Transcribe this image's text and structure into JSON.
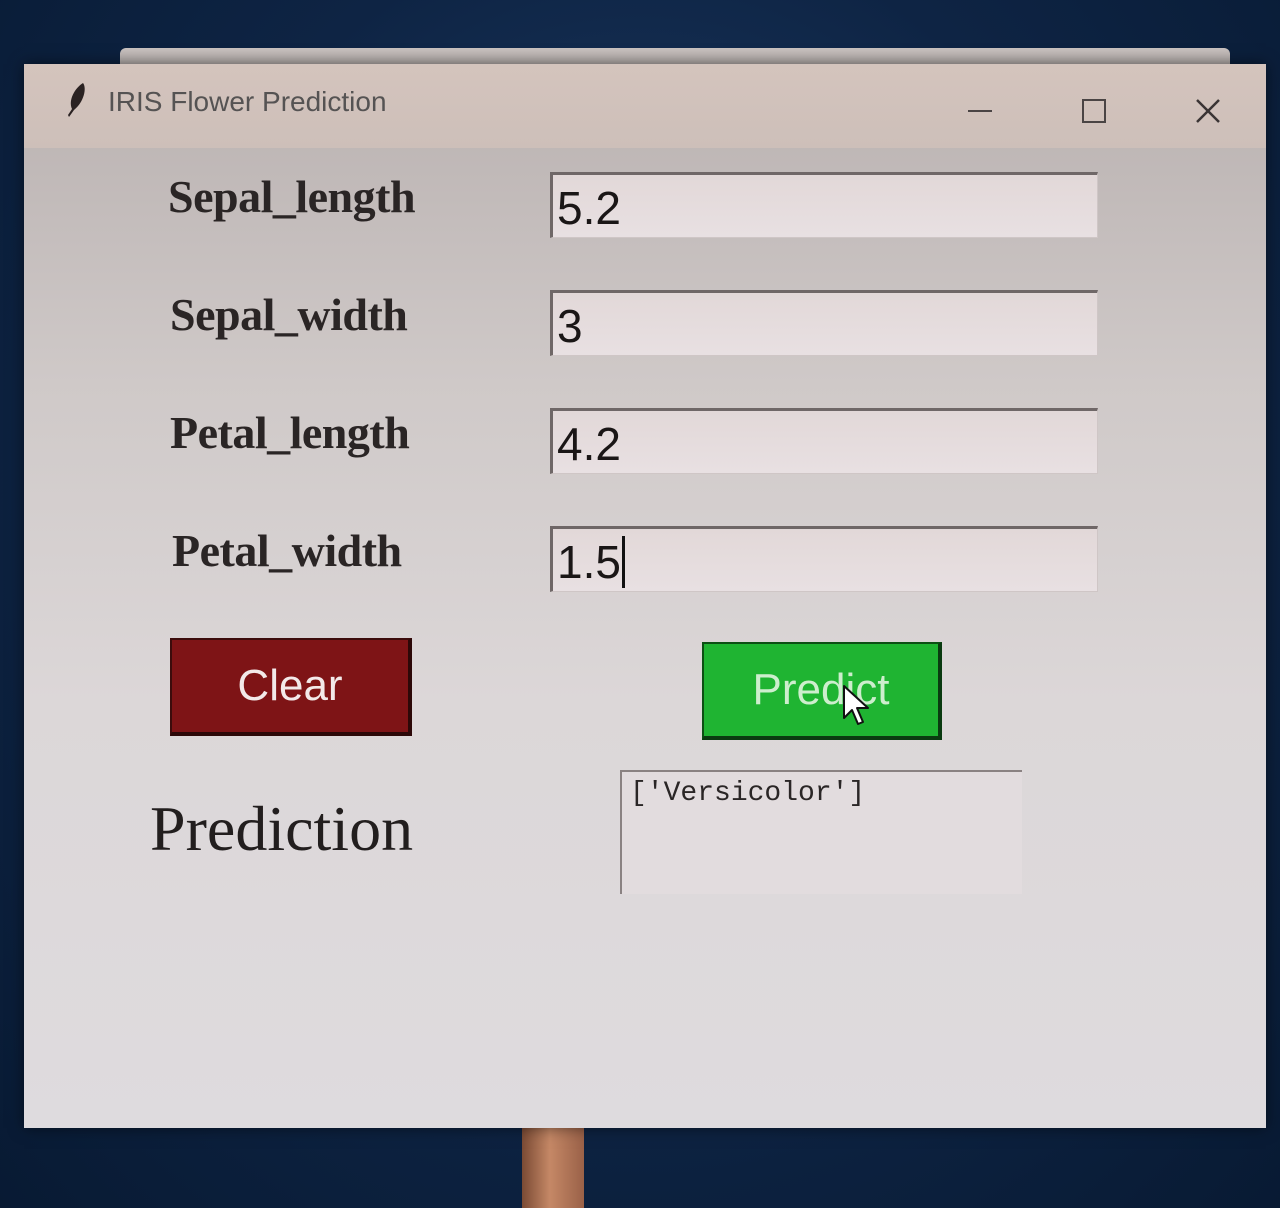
{
  "window": {
    "title": "IRIS Flower Prediction",
    "icon": "feather-icon",
    "controls": [
      "minimize-icon",
      "maximize-icon",
      "close-icon"
    ]
  },
  "fields": [
    {
      "label": "Sepal_length",
      "value": "5.2"
    },
    {
      "label": "Sepal_width",
      "value": "3"
    },
    {
      "label": "Petal_length",
      "value": "4.2"
    },
    {
      "label": "Petal_width",
      "value": "1.5"
    }
  ],
  "buttons": {
    "clear": {
      "label": "Clear",
      "color": "#7e1416"
    },
    "predict": {
      "label": "Predict",
      "color": "#1fb432"
    }
  },
  "prediction": {
    "label": "Prediction",
    "output": "['Versicolor']"
  }
}
